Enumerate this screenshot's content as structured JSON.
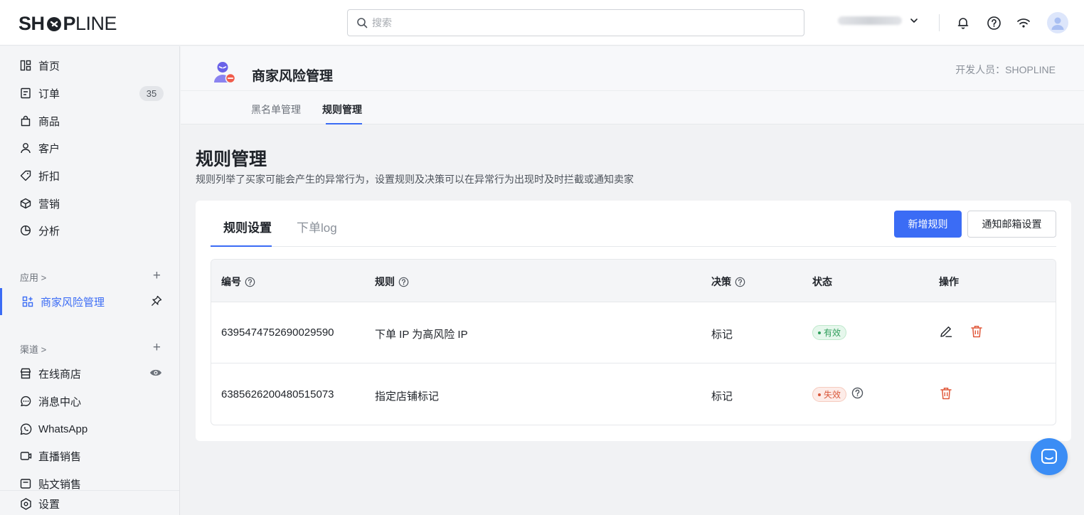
{
  "topbar": {
    "logo": {
      "bold": "SH",
      "bold2": "P",
      "light": "LINE"
    },
    "search_placeholder": "搜索"
  },
  "sidebar": {
    "items": [
      {
        "label": "首页",
        "icon": "home-icon"
      },
      {
        "label": "订单",
        "icon": "order-icon",
        "badge": "35"
      },
      {
        "label": "商品",
        "icon": "bag-icon"
      },
      {
        "label": "客户",
        "icon": "user-icon"
      },
      {
        "label": "折扣",
        "icon": "tag-icon"
      },
      {
        "label": "营销",
        "icon": "box-icon"
      },
      {
        "label": "分析",
        "icon": "pie-icon"
      }
    ],
    "apps_label": "应用 >",
    "active_app": "商家风险管理",
    "channels_label": "渠道 >",
    "channels": [
      {
        "label": "在线商店",
        "icon": "store-icon"
      },
      {
        "label": "消息中心",
        "icon": "message-icon"
      },
      {
        "label": "WhatsApp",
        "icon": "whatsapp-icon"
      },
      {
        "label": "直播销售",
        "icon": "live-icon"
      },
      {
        "label": "贴文销售",
        "icon": "post-icon"
      }
    ],
    "settings_label": "设置"
  },
  "app_header": {
    "title": "商家风险管理",
    "developer": "开发人员：SHOPLINE",
    "tabs": [
      "黑名单管理",
      "规则管理"
    ],
    "active_tab": "规则管理"
  },
  "page": {
    "title": "规则管理",
    "description": "规则列举了买家可能会产生的异常行为，设置规则及决策可以在异常行为出现时及时拦截或通知卖家"
  },
  "card": {
    "tabs": [
      "规则设置",
      "下单log"
    ],
    "add_button": "新增规则",
    "email_button": "通知邮箱设置",
    "columns": [
      "编号",
      "规则",
      "决策",
      "状态",
      "操作"
    ],
    "rows": [
      {
        "id": "6395474752690029590",
        "rule": "下单 IP 为高风险 IP",
        "decision": "标记",
        "status": "有效"
      },
      {
        "id": "6385626200480515073",
        "rule": "指定店铺标记",
        "decision": "标记",
        "status": "失效"
      }
    ]
  },
  "colors": {
    "accent": "#3b6cf5",
    "valid": "#2f9e5a",
    "invalid": "#d9583b"
  }
}
